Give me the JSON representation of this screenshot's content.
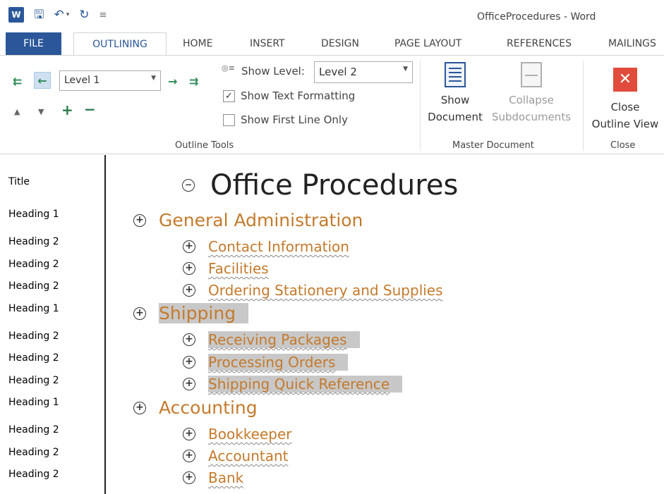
{
  "window": {
    "title": "OfficeProcedures - Word"
  },
  "qat": {
    "app_icon": "W",
    "undo_icon": "undo-icon",
    "redo_icon": "redo-icon",
    "save_icon": "save-icon"
  },
  "tabs": [
    {
      "label": "FILE"
    },
    {
      "label": "OUTLINING"
    },
    {
      "label": "HOME"
    },
    {
      "label": "INSERT"
    },
    {
      "label": "DESIGN"
    },
    {
      "label": "PAGE LAYOUT"
    },
    {
      "label": "REFERENCES"
    },
    {
      "label": "MAILINGS"
    }
  ],
  "ribbon": {
    "outline_tools": {
      "group_label": "Outline Tools",
      "level_value": "Level 1",
      "show_level_label": "Show Level:",
      "show_level_value": "Level 2",
      "show_text_formatting": {
        "label": "Show Text Formatting",
        "checked": true
      },
      "show_first_line_only": {
        "label": "Show First Line Only",
        "checked": false
      }
    },
    "master_document": {
      "group_label": "Master Document",
      "show_document_line1": "Show",
      "show_document_line2": "Document",
      "collapse_line1": "Collapse",
      "collapse_line2": "Subdocuments"
    },
    "close": {
      "group_label": "Close",
      "close_line1": "Close",
      "close_line2": "Outline View"
    }
  },
  "styles": [
    "Title",
    "Heading 1",
    "Heading 2",
    "Heading 2",
    "Heading 2",
    "Heading 1",
    "Heading 2",
    "Heading 2",
    "Heading 2",
    "Heading 1",
    "Heading 2",
    "Heading 2",
    "Heading 2"
  ],
  "outline": [
    {
      "level": "title",
      "symbol": "minus",
      "text": "Office Procedures"
    },
    {
      "level": "h1",
      "symbol": "plus",
      "text": "General Administration"
    },
    {
      "level": "h2",
      "symbol": "plus",
      "text": "Contact Information"
    },
    {
      "level": "h2",
      "symbol": "plus",
      "text": "Facilities"
    },
    {
      "level": "h2",
      "symbol": "plus",
      "text": "Ordering Stationery and Supplies"
    },
    {
      "level": "h1",
      "symbol": "plus",
      "text": "Shipping",
      "selected": true
    },
    {
      "level": "h2",
      "symbol": "plus",
      "text": "Receiving Packages",
      "selected": true
    },
    {
      "level": "h2",
      "symbol": "plus",
      "text": "Processing Orders",
      "selected": true
    },
    {
      "level": "h2",
      "symbol": "plus",
      "text": "Shipping Quick Reference",
      "selected": true
    },
    {
      "level": "h1",
      "symbol": "plus",
      "text": "Accounting"
    },
    {
      "level": "h2",
      "symbol": "plus",
      "text": "Bookkeeper"
    },
    {
      "level": "h2",
      "symbol": "plus",
      "text": "Accountant"
    },
    {
      "level": "h2",
      "symbol": "plus",
      "text": "Bank"
    }
  ],
  "colors": {
    "accent": "#2b579a",
    "heading": "#c47a2c",
    "selection": "#c8c8c8",
    "close": "#e14b3b"
  }
}
